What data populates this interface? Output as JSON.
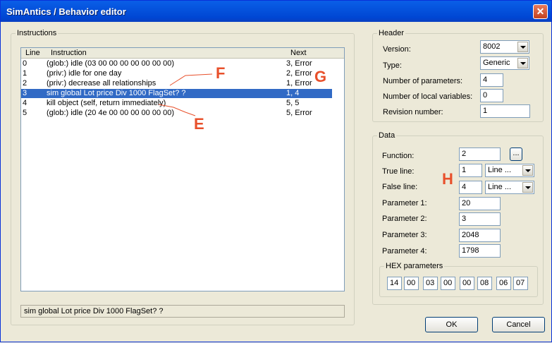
{
  "window": {
    "title": "SimAntics / Behavior editor",
    "close_glyph": "✕"
  },
  "instructions": {
    "group_label": "Instructions",
    "columns": {
      "line": "Line",
      "instruction": "Instruction",
      "next": "Next"
    },
    "rows": [
      {
        "line": "0",
        "instruction": "(glob:) idle (03 00 00 00 00 00 00 00)",
        "next": "3, Error"
      },
      {
        "line": "1",
        "instruction": "(priv:) idle for one day",
        "next": "2, Error"
      },
      {
        "line": "2",
        "instruction": "(priv:) decrease all relationships",
        "next": "1, Error"
      },
      {
        "line": "3",
        "instruction": "sim global Lot price Div 1000 FlagSet? ?",
        "next": "1, 4"
      },
      {
        "line": "4",
        "instruction": "kill object (self, return immediately)",
        "next": "5, 5"
      },
      {
        "line": "5",
        "instruction": "(glob:) idle (20 4e 00 00 00 00 00 00)",
        "next": "5, Error"
      }
    ],
    "status_text": "sim global Lot price Div 1000 FlagSet? ?"
  },
  "header": {
    "group_label": "Header",
    "version_label": "Version:",
    "version_value": "8002",
    "type_label": "Type:",
    "type_value": "Generic",
    "num_params_label": "Number of parameters:",
    "num_params_value": "4",
    "num_locals_label": "Number of local variables:",
    "num_locals_value": "0",
    "revision_label": "Revision number:",
    "revision_value": "1"
  },
  "data": {
    "group_label": "Data",
    "function_label": "Function:",
    "function_value": "2",
    "browse_label": "...",
    "true_line_label": "True line:",
    "true_line_value": "1",
    "true_line_combo": "Line ...",
    "false_line_label": "False line:",
    "false_line_value": "4",
    "false_line_combo": "Line ...",
    "param1_label": "Parameter 1:",
    "param1_value": "20",
    "param2_label": "Parameter 2:",
    "param2_value": "3",
    "param3_label": "Parameter 3:",
    "param3_value": "2048",
    "param4_label": "Parameter 4:",
    "param4_value": "1798",
    "hex_label": "HEX parameters",
    "hex": [
      "14",
      "00",
      "03",
      "00",
      "00",
      "08",
      "06",
      "07"
    ]
  },
  "buttons": {
    "ok": "OK",
    "cancel": "Cancel"
  },
  "markers": {
    "f": "F",
    "g": "G",
    "e": "E",
    "h": "H"
  }
}
